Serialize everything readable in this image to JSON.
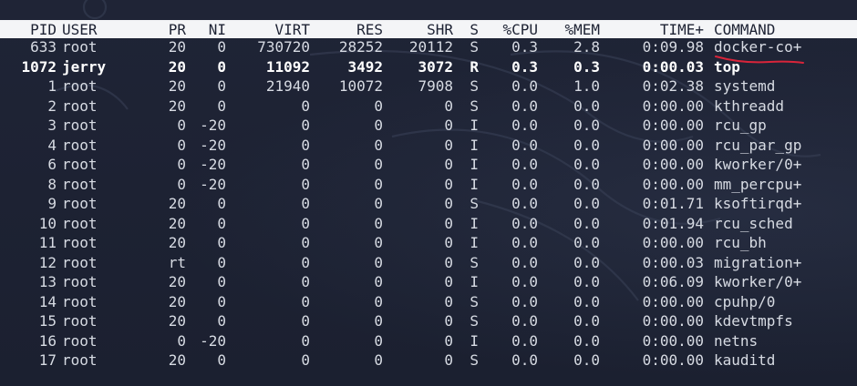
{
  "header": {
    "pid": "PID",
    "user": "USER",
    "pr": "PR",
    "ni": "NI",
    "virt": "VIRT",
    "res": "RES",
    "shr": "SHR",
    "s": "S",
    "cpu": "%CPU",
    "mem": "%MEM",
    "time": "TIME+",
    "command": "COMMAND"
  },
  "colors": {
    "background": "#1d2233",
    "header_bg": "#f4f5f7",
    "header_text": "#1d2233",
    "text": "#d7dbe3",
    "highlight_text": "#ffffff",
    "annotation": "#d8243a"
  },
  "annotation": {
    "type": "red-underline",
    "target": "processes.0.command"
  },
  "processes": [
    {
      "pid": "633",
      "user": "root",
      "pr": "20",
      "ni": "0",
      "virt": "730720",
      "res": "28252",
      "shr": "20112",
      "s": "S",
      "cpu": "0.3",
      "mem": "2.8",
      "time": "0:09.98",
      "command": "docker-co+",
      "bold": false
    },
    {
      "pid": "1072",
      "user": "jerry",
      "pr": "20",
      "ni": "0",
      "virt": "11092",
      "res": "3492",
      "shr": "3072",
      "s": "R",
      "cpu": "0.3",
      "mem": "0.3",
      "time": "0:00.03",
      "command": "top",
      "bold": true
    },
    {
      "pid": "1",
      "user": "root",
      "pr": "20",
      "ni": "0",
      "virt": "21940",
      "res": "10072",
      "shr": "7908",
      "s": "S",
      "cpu": "0.0",
      "mem": "1.0",
      "time": "0:02.38",
      "command": "systemd",
      "bold": false
    },
    {
      "pid": "2",
      "user": "root",
      "pr": "20",
      "ni": "0",
      "virt": "0",
      "res": "0",
      "shr": "0",
      "s": "S",
      "cpu": "0.0",
      "mem": "0.0",
      "time": "0:00.00",
      "command": "kthreadd",
      "bold": false
    },
    {
      "pid": "3",
      "user": "root",
      "pr": "0",
      "ni": "-20",
      "virt": "0",
      "res": "0",
      "shr": "0",
      "s": "I",
      "cpu": "0.0",
      "mem": "0.0",
      "time": "0:00.00",
      "command": "rcu_gp",
      "bold": false
    },
    {
      "pid": "4",
      "user": "root",
      "pr": "0",
      "ni": "-20",
      "virt": "0",
      "res": "0",
      "shr": "0",
      "s": "I",
      "cpu": "0.0",
      "mem": "0.0",
      "time": "0:00.00",
      "command": "rcu_par_gp",
      "bold": false
    },
    {
      "pid": "6",
      "user": "root",
      "pr": "0",
      "ni": "-20",
      "virt": "0",
      "res": "0",
      "shr": "0",
      "s": "I",
      "cpu": "0.0",
      "mem": "0.0",
      "time": "0:00.00",
      "command": "kworker/0+",
      "bold": false
    },
    {
      "pid": "8",
      "user": "root",
      "pr": "0",
      "ni": "-20",
      "virt": "0",
      "res": "0",
      "shr": "0",
      "s": "I",
      "cpu": "0.0",
      "mem": "0.0",
      "time": "0:00.00",
      "command": "mm_percpu+",
      "bold": false
    },
    {
      "pid": "9",
      "user": "root",
      "pr": "20",
      "ni": "0",
      "virt": "0",
      "res": "0",
      "shr": "0",
      "s": "S",
      "cpu": "0.0",
      "mem": "0.0",
      "time": "0:01.71",
      "command": "ksoftirqd+",
      "bold": false
    },
    {
      "pid": "10",
      "user": "root",
      "pr": "20",
      "ni": "0",
      "virt": "0",
      "res": "0",
      "shr": "0",
      "s": "I",
      "cpu": "0.0",
      "mem": "0.0",
      "time": "0:01.94",
      "command": "rcu_sched",
      "bold": false
    },
    {
      "pid": "11",
      "user": "root",
      "pr": "20",
      "ni": "0",
      "virt": "0",
      "res": "0",
      "shr": "0",
      "s": "I",
      "cpu": "0.0",
      "mem": "0.0",
      "time": "0:00.00",
      "command": "rcu_bh",
      "bold": false
    },
    {
      "pid": "12",
      "user": "root",
      "pr": "rt",
      "ni": "0",
      "virt": "0",
      "res": "0",
      "shr": "0",
      "s": "S",
      "cpu": "0.0",
      "mem": "0.0",
      "time": "0:00.03",
      "command": "migration+",
      "bold": false
    },
    {
      "pid": "13",
      "user": "root",
      "pr": "20",
      "ni": "0",
      "virt": "0",
      "res": "0",
      "shr": "0",
      "s": "I",
      "cpu": "0.0",
      "mem": "0.0",
      "time": "0:06.09",
      "command": "kworker/0+",
      "bold": false
    },
    {
      "pid": "14",
      "user": "root",
      "pr": "20",
      "ni": "0",
      "virt": "0",
      "res": "0",
      "shr": "0",
      "s": "S",
      "cpu": "0.0",
      "mem": "0.0",
      "time": "0:00.00",
      "command": "cpuhp/0",
      "bold": false
    },
    {
      "pid": "15",
      "user": "root",
      "pr": "20",
      "ni": "0",
      "virt": "0",
      "res": "0",
      "shr": "0",
      "s": "S",
      "cpu": "0.0",
      "mem": "0.0",
      "time": "0:00.00",
      "command": "kdevtmpfs",
      "bold": false
    },
    {
      "pid": "16",
      "user": "root",
      "pr": "0",
      "ni": "-20",
      "virt": "0",
      "res": "0",
      "shr": "0",
      "s": "I",
      "cpu": "0.0",
      "mem": "0.0",
      "time": "0:00.00",
      "command": "netns",
      "bold": false
    },
    {
      "pid": "17",
      "user": "root",
      "pr": "20",
      "ni": "0",
      "virt": "0",
      "res": "0",
      "shr": "0",
      "s": "S",
      "cpu": "0.0",
      "mem": "0.0",
      "time": "0:00.00",
      "command": "kauditd",
      "bold": false
    }
  ]
}
